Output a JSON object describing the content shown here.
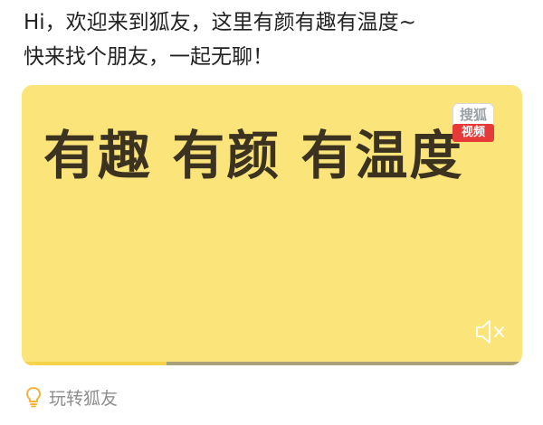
{
  "intro": {
    "line1": "Hi，欢迎来到狐友，这里有颜有趣有温度~",
    "line2": "快来找个朋友，一起无聊！"
  },
  "video": {
    "headline": "有趣 有颜 有温度",
    "watermark_top": "搜狐",
    "watermark_bottom": "视频",
    "progress_fraction": 0.29,
    "colors": {
      "background": "#fbe57b",
      "headline": "#3b3220",
      "progress_fill": "#f7d349",
      "progress_track": "#a9a17a",
      "watermark_red": "#e63a3a"
    },
    "icons": {
      "mute": "speaker-muted-icon"
    }
  },
  "tag": {
    "label": "玩转狐友",
    "icon": "lightbulb-icon",
    "color": "#f5b33d"
  }
}
